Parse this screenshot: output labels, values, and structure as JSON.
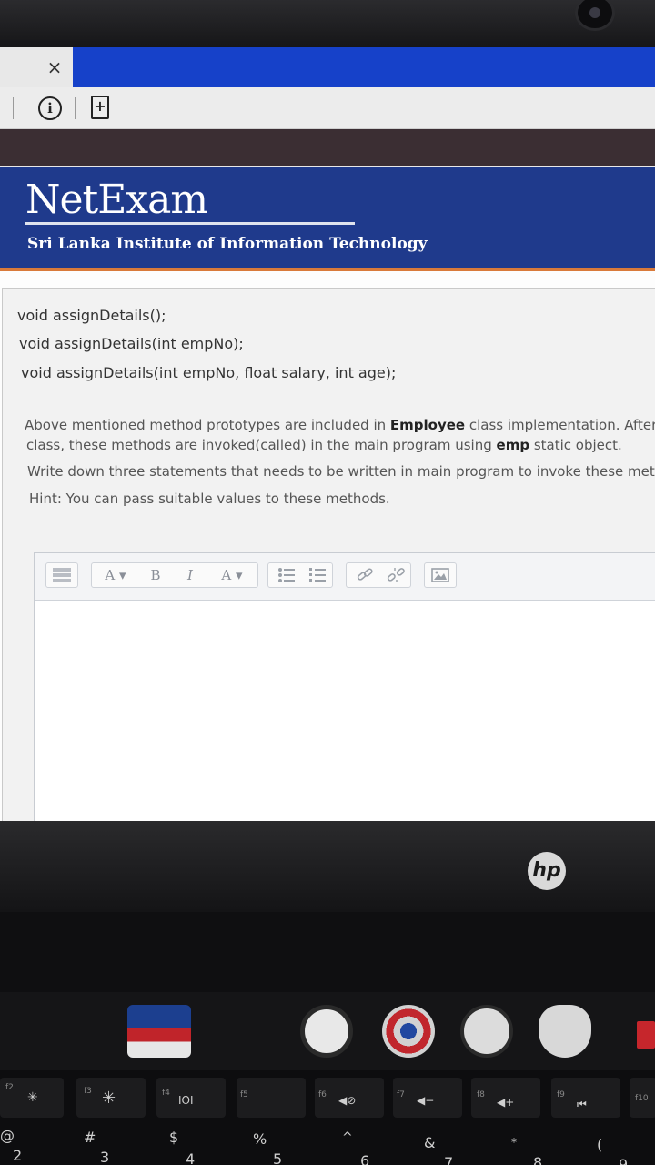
{
  "browser": {
    "tab_close": "×",
    "info_icon": "i",
    "new_page_icon": "+"
  },
  "header": {
    "logo": "NetExam",
    "institute": "Sri Lanka Institute of Information Technology"
  },
  "question": {
    "code_lines": [
      "void assignDetails();",
      "void assignDetails(int empNo);",
      "void assignDetails(int empNo, float salary, int age);"
    ],
    "para1_a": "Above mentioned method prototypes are included in ",
    "para1_b": "Employee",
    "para1_c": " class implementation. After i",
    "para2_a": "class, these methods are invoked(called) in the main program using ",
    "para2_b": "emp",
    "para2_c": " static object.",
    "para3": "Write down three statements that needs to be written in main program to invoke these metho",
    "hint": "Hint: You can pass suitable values to these methods."
  },
  "editor": {
    "font_size": "A",
    "bold": "B",
    "italic": "I",
    "font_color": "A"
  },
  "laptop": {
    "brand": "hp",
    "fkeys": [
      "f2",
      "f3",
      "f4",
      "f5",
      "f6",
      "f7",
      "f8",
      "f9",
      "f10"
    ],
    "fkey_icons": [
      "✳",
      "✳",
      "IOI",
      "",
      "◀⊘",
      "◀−",
      "◀+",
      "⏮",
      ""
    ],
    "numrow": [
      "@",
      "#",
      "$",
      "%",
      "^",
      "&",
      "*",
      "("
    ],
    "numrow_digits": [
      "2",
      "3",
      "4",
      "5",
      "6",
      "7",
      "8",
      "9"
    ]
  }
}
